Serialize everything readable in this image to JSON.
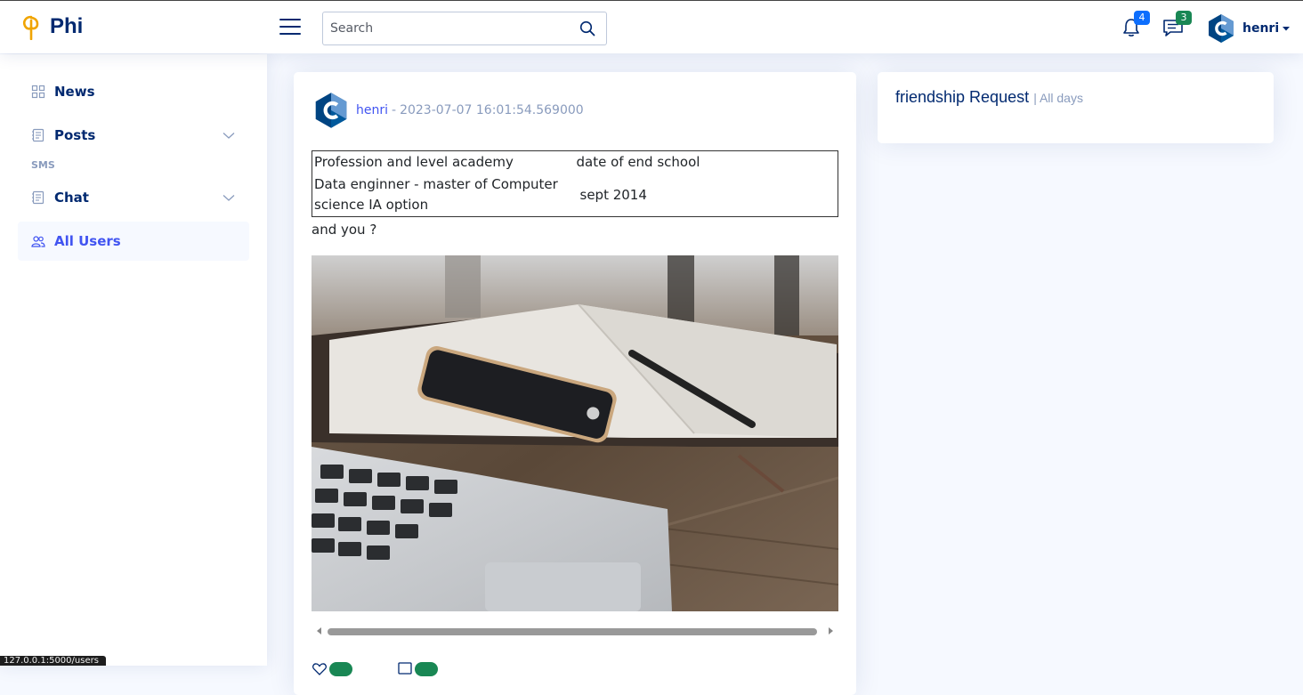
{
  "header": {
    "brand": "Phi",
    "search_placeholder": "Search",
    "search_value": "",
    "notifications_count": "4",
    "messages_count": "3",
    "user_name": "henri"
  },
  "sidebar": {
    "items": [
      {
        "label": "News",
        "icon": "grid-icon"
      },
      {
        "label": "Posts",
        "icon": "journal-icon"
      },
      {
        "heading": "SMS"
      },
      {
        "label": "Chat",
        "icon": "journal-icon"
      },
      {
        "label": "All Users",
        "icon": "people-icon"
      }
    ]
  },
  "post": {
    "author": "henri",
    "separator": "-",
    "timestamp": "2023-07-07 16:01:54.569000",
    "table": {
      "row1": [
        "Profession and level academy",
        "date of end school"
      ],
      "row2": [
        "Data enginner - master of Computer science IA option",
        "sept 2014"
      ]
    },
    "after_text": "and you ?"
  },
  "friend_request": {
    "title": "friendship Request",
    "subtitle": "| All days"
  },
  "status_bar": {
    "url": "127.0.0.1:5000/users"
  },
  "colors": {
    "brand_navy": "#012970",
    "accent_blue": "#4154f1",
    "muted": "#899bbd",
    "badge_blue": "#0d6efd",
    "badge_green": "#198754"
  }
}
